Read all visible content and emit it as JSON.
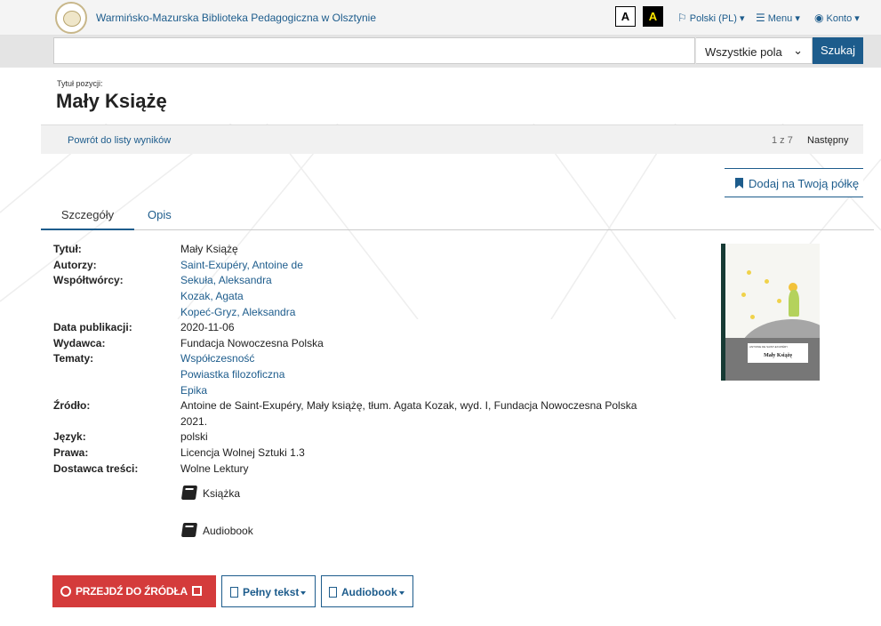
{
  "header": {
    "library_name": "Warmińsko-Mazurska Biblioteka Pedagogiczna w Olsztynie",
    "contrast_normal": "A",
    "contrast_high": "A",
    "language": "Polski (PL)",
    "menu": "Menu",
    "account": "Konto"
  },
  "search": {
    "value": "",
    "field_select": "Wszystkie pola",
    "button": "Szukaj"
  },
  "record": {
    "title_label": "Tytuł pozycji:",
    "title": "Mały Książę"
  },
  "result_nav": {
    "back": "Powrót do listy wyników",
    "count": "1 z 7",
    "next": "Następny"
  },
  "actions": {
    "add_to_shelf": "Dodaj na Twoją półkę"
  },
  "tabs": [
    "Szczegóły",
    "Opis"
  ],
  "details": {
    "title_label": "Tytuł:",
    "title": "Mały Książę",
    "authors_label": "Autorzy:",
    "authors": [
      "Saint-Exupéry, Antoine de"
    ],
    "contributors_label": "Współtwórcy:",
    "contributors": [
      "Sekuła, Aleksandra",
      "Kozak, Agata",
      "Kopeć-Gryz, Aleksandra"
    ],
    "date_label": "Data publikacji:",
    "date": "2020-11-06",
    "publisher_label": "Wydawca:",
    "publisher": "Fundacja Nowoczesna Polska",
    "subjects_label": "Tematy:",
    "subjects": [
      "Współczesność",
      "Powiastka filozoficzna",
      "Epika"
    ],
    "source_label": "Źródło:",
    "source_line1": "Antoine de Saint-Exupéry, Mały książę, tłum. Agata Kozak, wyd. I, Fundacja Nowoczesna Polska",
    "source_line2": "2021.",
    "language_label": "Język:",
    "language": "polski",
    "rights_label": "Prawa:",
    "rights": "Licencja Wolnej Sztuki 1.3",
    "provider_label": "Dostawca treści:",
    "provider": "Wolne Lektury"
  },
  "formats": [
    "Książka",
    "Audiobook"
  ],
  "cover": {
    "author": "ANTOINE DE SAINT-EXUPÉRY",
    "title": "Mały Książę"
  },
  "buttons": {
    "go_to_source": "PRZEJDŹ DO ŹRÓDŁA",
    "full_text": "Pełny tekst",
    "audiobook": "Audiobook"
  },
  "colors": {
    "primary": "#1d5c8c",
    "danger": "#d43b3b"
  }
}
